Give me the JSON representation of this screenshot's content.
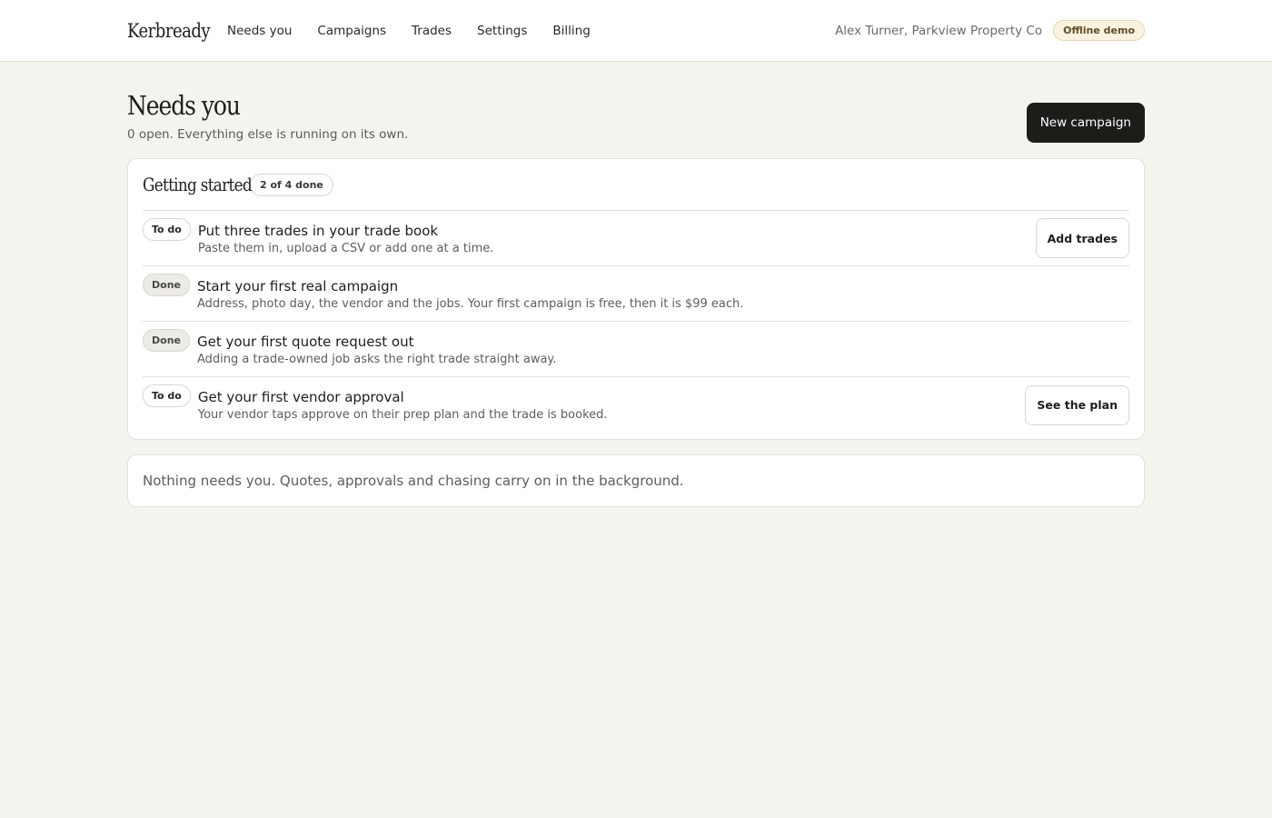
{
  "header": {
    "brand": "Kerbready",
    "nav": [
      {
        "label": "Needs you"
      },
      {
        "label": "Campaigns"
      },
      {
        "label": "Trades"
      },
      {
        "label": "Settings"
      },
      {
        "label": "Billing"
      }
    ],
    "account": "Alex Turner, Parkview Property Co",
    "mode_badge": "Offline demo"
  },
  "page": {
    "title": "Needs you",
    "subtitle": "0 open. Everything else is running on its own.",
    "new_campaign_label": "New campaign"
  },
  "getting_started": {
    "title": "Getting started",
    "progress": "2 of 4 done",
    "tasks": [
      {
        "status": "To do",
        "title": "Put three trades in your trade book",
        "description": "Paste them in, upload a CSV or add one at a time.",
        "action": "Add trades"
      },
      {
        "status": "Done",
        "title": "Start your first real campaign",
        "description": "Address, photo day, the vendor and the jobs. Your first campaign is free, then it is $99 each."
      },
      {
        "status": "Done",
        "title": "Get your first quote request out",
        "description": "Adding a trade-owned job asks the right trade straight away."
      },
      {
        "status": "To do",
        "title": "Get your first vendor approval",
        "description": "Your vendor taps approve on their prep plan and the trade is booked.",
        "action": "See the plan"
      }
    ]
  },
  "notice": "Nothing needs you. Quotes, approvals and chasing carry on in the background.",
  "colors": {
    "background": "#f4f3ee",
    "primary_button": "#1d1c19",
    "badge_bg": "#fbf2df"
  }
}
